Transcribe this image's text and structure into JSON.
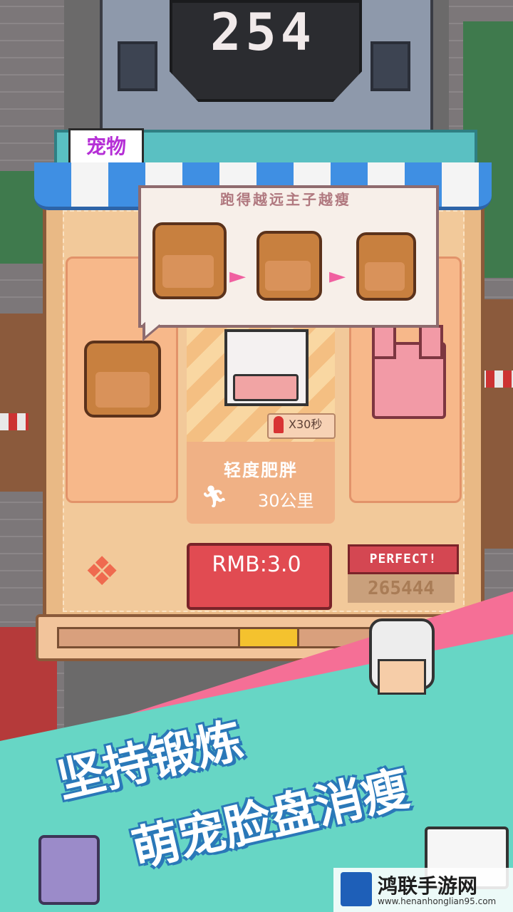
{
  "header": {
    "score": "254"
  },
  "shop": {
    "tab_label": "宠物",
    "tooltip_title": "跑得越远主子越瘦"
  },
  "pet_card": {
    "boost_badge": "X30秒",
    "status_title": "轻度肥胖",
    "distance": "30公里"
  },
  "purchase": {
    "price_label": "RMB:3.0"
  },
  "result": {
    "perfect_label": "PERFECT!",
    "perfect_score": "265444"
  },
  "promo": {
    "line1": "坚持锻炼",
    "line2": "萌宠脸盘消瘦"
  },
  "watermark": {
    "title": "鸿联手游网",
    "url": "www.henanhonglian95.com"
  },
  "colors": {
    "accent_purple": "#b52fd6",
    "price_red": "#e14b52",
    "teal": "#67d6c5",
    "pink": "#f56f96"
  },
  "icons": [
    "rocket-icon",
    "runner-icon",
    "paw-icon",
    "arrow-right-icon"
  ]
}
